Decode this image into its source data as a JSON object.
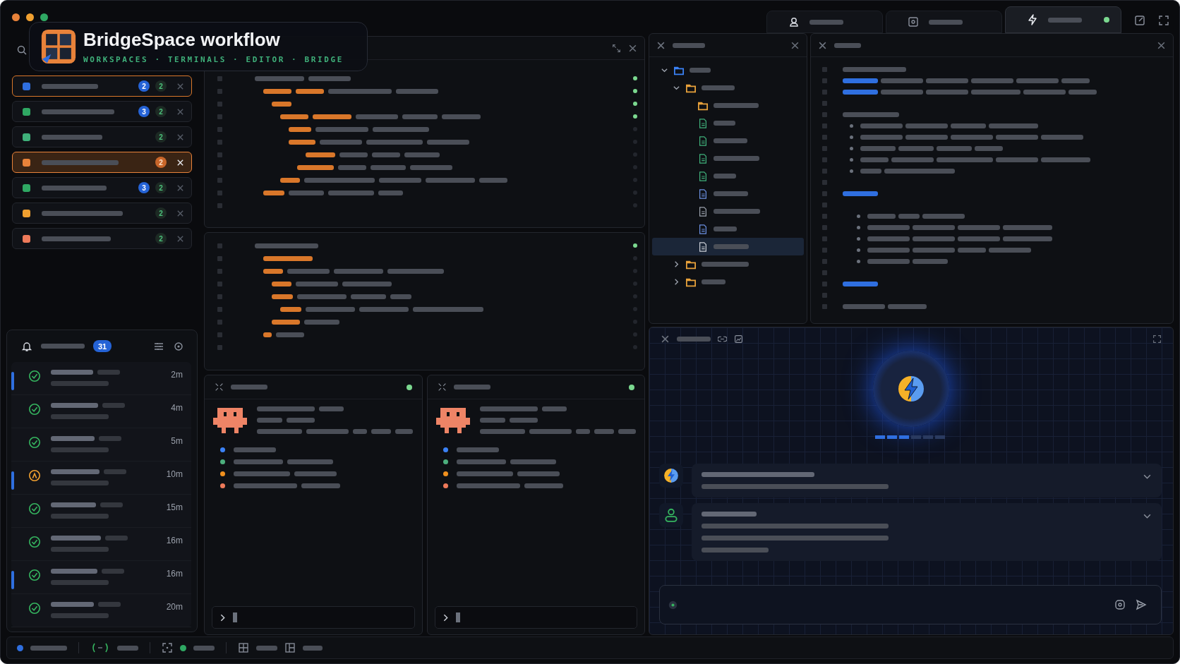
{
  "title_card": {
    "title": "BridgeSpace workflow",
    "subtitle": "WORKSPACES · TERMINALS · EDITOR · BRIDGE"
  },
  "top_tabs": [
    {
      "kind": "user",
      "selected": false,
      "live": false
    },
    {
      "kind": "window",
      "selected": false,
      "live": false
    },
    {
      "kind": "bolt",
      "selected": true,
      "live": true
    }
  ],
  "workspaces": [
    {
      "color": "#2f6fe0",
      "outlined": true,
      "selected": false,
      "unread": "2",
      "count": "2"
    },
    {
      "color": "#2fa863",
      "outlined": false,
      "selected": false,
      "unread": "3",
      "count": "2"
    },
    {
      "color": "#3fb07a",
      "outlined": false,
      "selected": false,
      "count": "2"
    },
    {
      "color": "#e8823a",
      "outlined": false,
      "selected": true,
      "count": "2"
    },
    {
      "color": "#2fa863",
      "outlined": false,
      "selected": false,
      "unread": "3",
      "count": "2"
    },
    {
      "color": "#f0a030",
      "outlined": false,
      "selected": false,
      "count": "2"
    },
    {
      "color": "#ee7a5a",
      "outlined": false,
      "selected": false,
      "count": "2"
    }
  ],
  "notifications": {
    "count": "31",
    "items": [
      {
        "kind": "done",
        "time": "2m",
        "unread": true
      },
      {
        "kind": "done",
        "time": "4m",
        "unread": false
      },
      {
        "kind": "done",
        "time": "5m",
        "unread": false
      },
      {
        "kind": "attention",
        "time": "10m",
        "unread": true
      },
      {
        "kind": "done",
        "time": "15m",
        "unread": false
      },
      {
        "kind": "done",
        "time": "16m",
        "unread": false
      },
      {
        "kind": "done",
        "time": "16m",
        "unread": true
      },
      {
        "kind": "done",
        "time": "20m",
        "unread": false
      }
    ]
  },
  "terminals": [
    {
      "live": true,
      "bullets": [
        {
          "color": "#3b82f6"
        },
        {
          "color": "#4caf7d"
        },
        {
          "color": "#f0901e"
        },
        {
          "color": "#ee7a5a"
        }
      ]
    },
    {
      "live": true,
      "bullets": [
        {
          "color": "#3b82f6"
        },
        {
          "color": "#4caf7d"
        },
        {
          "color": "#f0901e"
        },
        {
          "color": "#ee7a5a"
        }
      ]
    }
  ],
  "file_tree": [
    {
      "kind": "folder",
      "color": "#3b82f6",
      "expanded": true,
      "selected": false,
      "children": [
        {
          "kind": "folder",
          "color": "#e9a23b",
          "expanded": true,
          "selected": false,
          "children": [
            {
              "kind": "folder",
              "color": "#e9a23b",
              "selected": false
            },
            {
              "kind": "file",
              "color": "#3fb07a",
              "selected": false
            },
            {
              "kind": "file",
              "color": "#3fb07a",
              "selected": false
            },
            {
              "kind": "file",
              "color": "#3fb07a",
              "selected": false
            },
            {
              "kind": "file",
              "color": "#3fb07a",
              "selected": false
            },
            {
              "kind": "file",
              "color": "#6b8fe0",
              "selected": false
            },
            {
              "kind": "file",
              "color": "#9aa0ab",
              "selected": false
            },
            {
              "kind": "file",
              "color": "#6b8fe0",
              "selected": false
            },
            {
              "kind": "file",
              "color": "#c8ccd4",
              "selected": true
            }
          ]
        },
        {
          "kind": "folder",
          "color": "#e9a23b",
          "expanded": false,
          "selected": false
        },
        {
          "kind": "folder",
          "color": "#e9a23b",
          "expanded": false,
          "selected": false
        }
      ]
    }
  ],
  "bridge": {
    "level": 0.5,
    "messages": [
      {
        "kind": "assistant"
      },
      {
        "kind": "user"
      }
    ]
  }
}
